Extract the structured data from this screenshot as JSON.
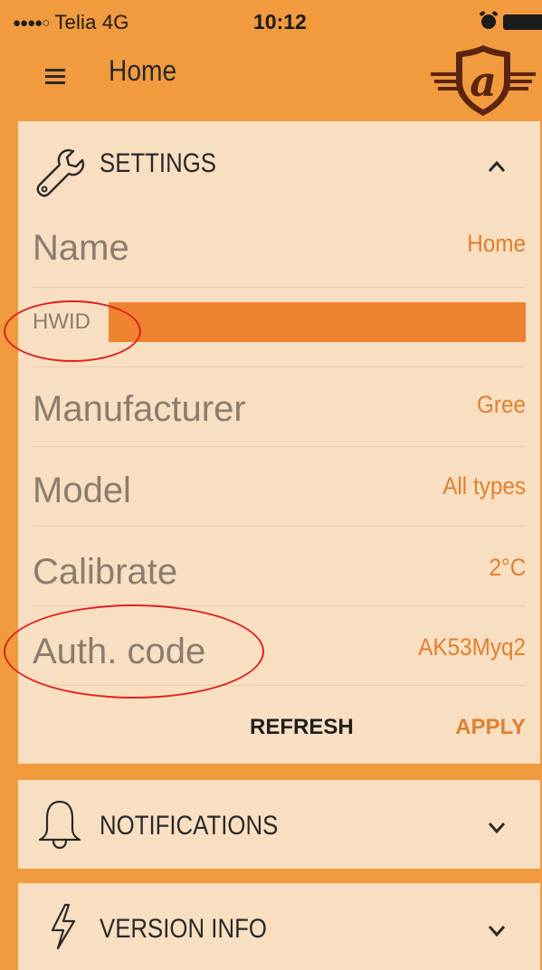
{
  "status_bar": {
    "signal": "●●●●○",
    "carrier": "Telia  4G",
    "time": "10:12"
  },
  "header": {
    "title": "Home",
    "logo_letter": "a"
  },
  "settings": {
    "title": "SETTINGS",
    "fields": {
      "name": {
        "label": "Name",
        "value": "Home"
      },
      "hwid": {
        "label": "HWID",
        "value": ""
      },
      "manufacturer": {
        "label": "Manufacturer",
        "value": "Gree"
      },
      "model": {
        "label": "Model",
        "value": "All types"
      },
      "calibrate": {
        "label": "Calibrate",
        "value": "2°C"
      },
      "auth_code": {
        "label": "Auth. code",
        "value": "AK53Myq2"
      }
    },
    "refresh_label": "REFRESH",
    "apply_label": "APPLY"
  },
  "notifications": {
    "title": "NOTIFICATIONS"
  },
  "version_info": {
    "title": "VERSION INFO"
  },
  "colors": {
    "background": "#f29a3e",
    "panel": "#f8dfc2",
    "accent": "#e07f2f",
    "hwid_bar": "#ee8330",
    "annotation": "#e02020",
    "logo_dark": "#5a2410"
  }
}
